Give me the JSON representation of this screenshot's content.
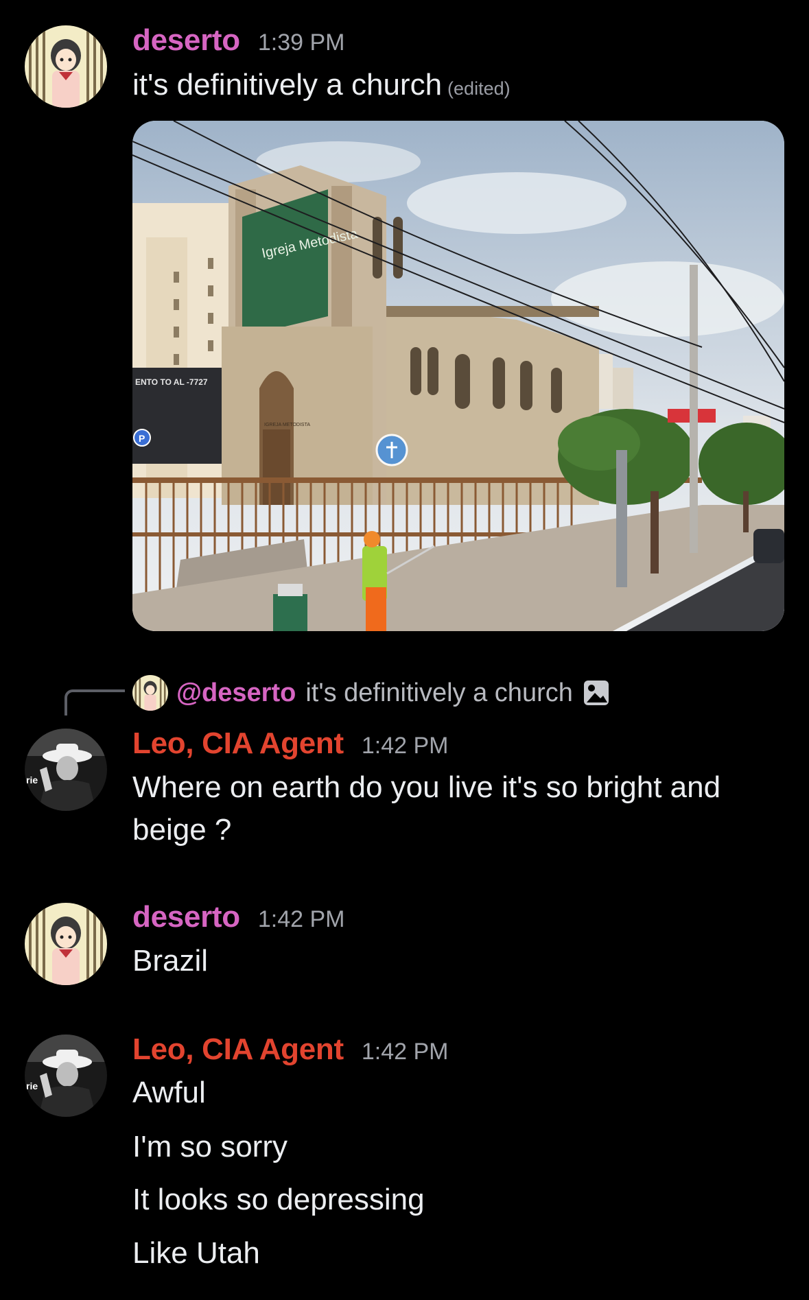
{
  "messages": [
    {
      "author": "deserto",
      "time": "1:39 PM",
      "text": "it's definitively a church",
      "edited": "(edited)",
      "attachment": {
        "type": "image",
        "sign_text": "Igreja Metodista",
        "panel_text": "ENTO TO AL -7727",
        "door_text": "IGREJA METODISTA"
      }
    },
    {
      "reply_to": {
        "mention": "@deserto",
        "text": "it's definitively a church",
        "icon": "image-icon"
      },
      "author": "Leo, CIA Agent",
      "time": "1:42 PM",
      "lines": [
        "Where on earth do you live it's so bright and",
        "beige ?"
      ]
    },
    {
      "author": "deserto",
      "time": "1:42 PM",
      "lines": [
        "Brazil"
      ]
    },
    {
      "author": "Leo, CIA Agent",
      "time": "1:42 PM",
      "lines": [
        "Awful",
        "I'm so sorry",
        "It looks so depressing",
        "Like Utah"
      ]
    }
  ],
  "colors": {
    "background": "#000000",
    "deserto_name": "#d665c2",
    "leo_name": "#e2442f",
    "timestamp": "#a1a4ab",
    "message_text": "#eceef1"
  }
}
